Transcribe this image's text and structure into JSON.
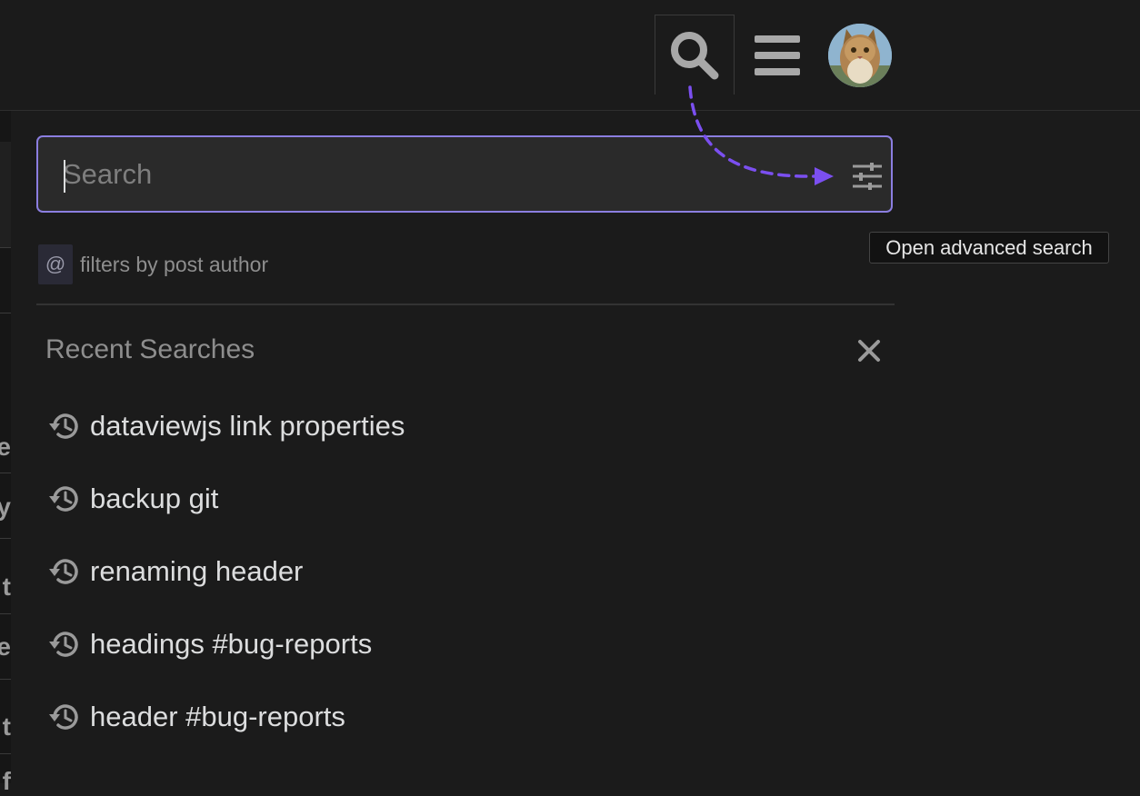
{
  "header": {
    "search_button": "search-icon",
    "menu_button": "hamburger-menu-icon",
    "avatar": "user-avatar-cat"
  },
  "search": {
    "placeholder": "Search",
    "value": "",
    "advanced_icon": "sliders-icon"
  },
  "hint": {
    "symbol": "@",
    "text": "filters by post author"
  },
  "recent": {
    "title": "Recent Searches",
    "clear_icon": "close-icon",
    "items": [
      {
        "label": "dataviewjs link properties"
      },
      {
        "label": "backup git"
      },
      {
        "label": "renaming header"
      },
      {
        "label": "headings #bug-reports"
      },
      {
        "label": "header #bug-reports"
      }
    ]
  },
  "tooltip": {
    "text": "Open advanced search"
  },
  "background_fragments": [
    "e",
    "y",
    "t",
    "le",
    "t",
    "f"
  ],
  "colors": {
    "accent": "#8b7ee0",
    "arrow": "#7b4ff0",
    "background": "#1b1b1b",
    "input_bg": "#2a2a2a"
  }
}
